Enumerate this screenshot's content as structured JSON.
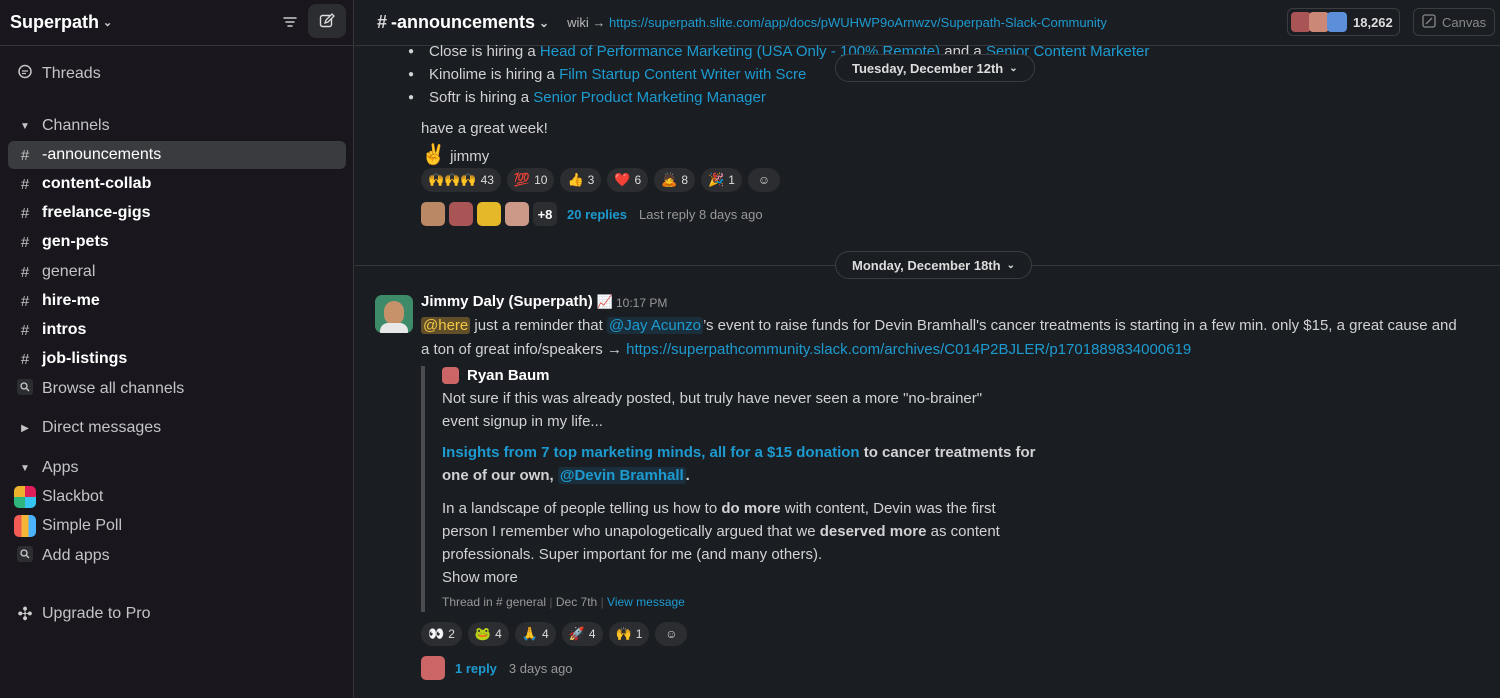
{
  "workspace": {
    "name": "Superpath"
  },
  "sidebar": {
    "threads": "Threads",
    "channels_header": "Channels",
    "channels": [
      {
        "name": "-announcements",
        "bold": false,
        "active": true
      },
      {
        "name": "content-collab",
        "bold": true
      },
      {
        "name": "freelance-gigs",
        "bold": true
      },
      {
        "name": "gen-pets",
        "bold": true
      },
      {
        "name": "general",
        "bold": false
      },
      {
        "name": "hire-me",
        "bold": true
      },
      {
        "name": "intros",
        "bold": true
      },
      {
        "name": "job-listings",
        "bold": true
      }
    ],
    "browse": "Browse all channels",
    "dm_header": "Direct messages",
    "apps_header": "Apps",
    "apps": [
      "Slackbot",
      "Simple Poll"
    ],
    "add_apps": "Add apps",
    "upgrade": "Upgrade to Pro"
  },
  "header": {
    "channel": "-announcements",
    "topic_prefix": "wiki →",
    "topic_link": "https://superpath.slite.com/app/docs/pWUHWP9oArnwzv/Superpath-Slack-Community",
    "member_count": "18,262",
    "canvas_label": "Canvas"
  },
  "prev_message": {
    "bullets": [
      {
        "prefix": "Close is hiring a ",
        "link1": "Head of Performance Marketing (USA Only - 100% Remote)",
        "mid": " and a ",
        "link2": "Senior Content Marketer"
      },
      {
        "prefix": "Kinolime is hiring a ",
        "link1": "Film Startup Content Writer with Scre"
      },
      {
        "prefix": "Softr is hiring a ",
        "link1": "Senior Product Marketing Manager"
      }
    ],
    "closing": "have a great week!",
    "signoff": "jimmy",
    "reactions": [
      {
        "emoji": "🙌🙌🙌",
        "count": "43"
      },
      {
        "emoji": "💯",
        "count": "10"
      },
      {
        "emoji": "👍",
        "count": "3"
      },
      {
        "emoji": "❤️",
        "count": "6"
      },
      {
        "emoji": "🙇",
        "count": "8"
      },
      {
        "emoji": "🎉",
        "count": "1"
      }
    ],
    "extra_avatars": "+8",
    "reply_count": "20 replies",
    "last_reply": "Last reply 8 days ago"
  },
  "date_pills": {
    "top": "Tuesday, December 12th",
    "middle": "Monday, December 18th"
  },
  "message": {
    "sender": "Jimmy Daly (Superpath)",
    "status_emoji": "📈",
    "time": "10:17 PM",
    "here": "@here",
    "text1": " just a reminder that ",
    "mention": "@Jay Acunzo",
    "text2": "’s event to raise funds for Devin Bramhall's cancer treatments is starting in a few min. only $15, a great cause and",
    "text3": "a ton of great info/speakers → ",
    "link": "https://superpathcommunity.slack.com/archives/C014P2BJLER/p1701889834000619",
    "quote": {
      "author": "Ryan Baum",
      "line1": "Not sure if this was already posted, but truly have never seen a more \"no-brainer\"",
      "line2": "event signup in my life...",
      "link": "Insights from 7 top marketing minds, all for a $15 donation",
      "after_link": " to cancer treatments for",
      "line4a": "one of our own, ",
      "line4_mention": "@Devin Bramhall",
      "line4b": ".",
      "p3_1a": "In a landscape of people telling us how to ",
      "p3_1b": "do more",
      "p3_1c": " with content, Devin was the first",
      "p3_2a": "person I remember who unapologetically argued that we ",
      "p3_2b": "deserved more",
      "p3_2c": " as content",
      "p3_3": "professionals. Super important for me (and many others).",
      "show_more": "Show more",
      "footer_thread": "Thread in # general",
      "footer_date": "Dec 7th",
      "footer_view": "View message"
    },
    "reactions": [
      {
        "emoji": "👀",
        "count": "2"
      },
      {
        "emoji": "🐸",
        "count": "4"
      },
      {
        "emoji": "🙏",
        "count": "4"
      },
      {
        "emoji": "🚀",
        "count": "4"
      },
      {
        "emoji": "🙌",
        "count": "1"
      }
    ],
    "reply_count": "1 reply",
    "last_reply": "3 days ago"
  },
  "colors": {
    "link": "#1d9bd1",
    "bg": "#1a1d21",
    "sidebar": "#19171d"
  }
}
